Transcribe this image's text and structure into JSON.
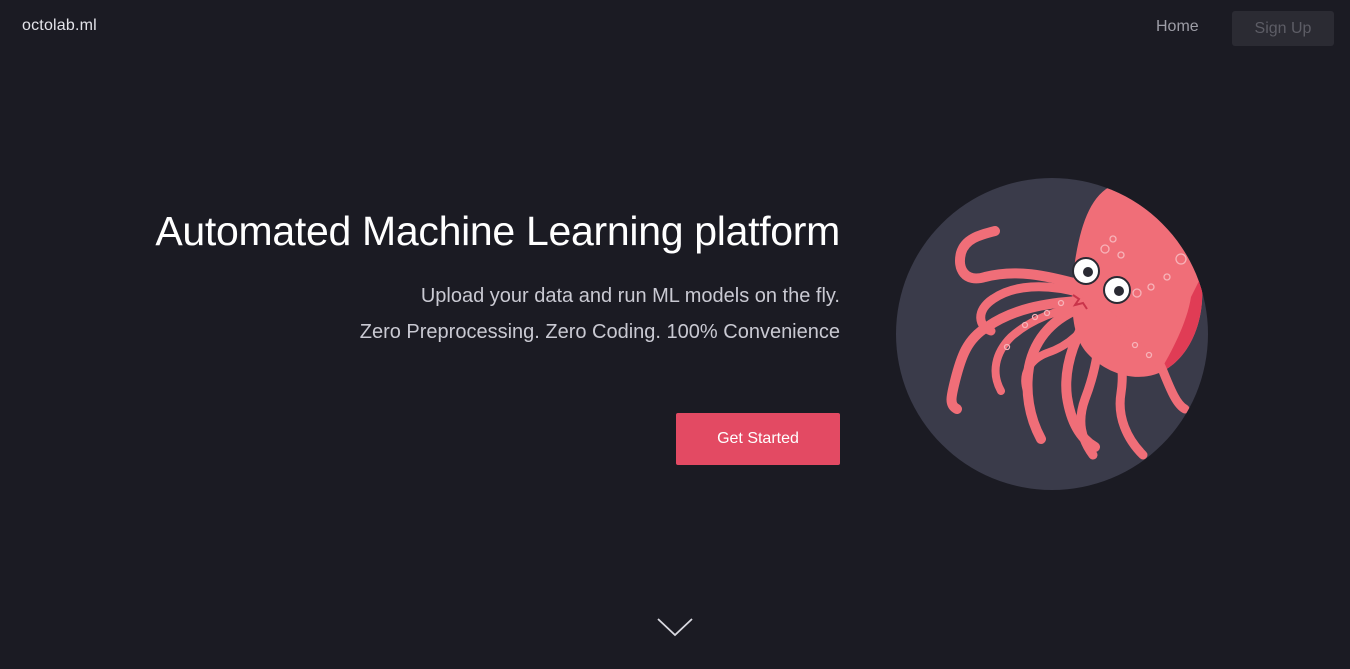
{
  "nav": {
    "brand": "octolab.ml",
    "home_label": "Home",
    "signup_label": "Sign Up"
  },
  "hero": {
    "title": "Automated Machine Learning platform",
    "subtitle_line1": "Upload your data and run ML models on the fly.",
    "subtitle_line2": "Zero Preprocessing. Zero Coding. 100% Convenience",
    "cta_label": "Get Started"
  },
  "illustration": {
    "icon": "octopus-illustration",
    "circle_color": "#3a3b4a",
    "octopus_color": "#f06e78"
  },
  "scroll": {
    "icon": "chevron-down-icon"
  },
  "colors": {
    "background": "#1b1b23",
    "accent": "#e34a63",
    "signup_bg": "#2b2b33"
  }
}
